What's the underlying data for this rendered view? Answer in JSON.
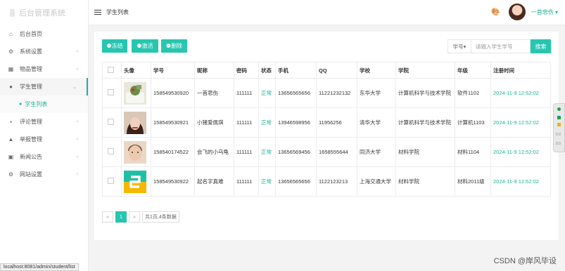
{
  "app": {
    "title": "后台管理系统"
  },
  "header": {
    "page_title": "学生列表",
    "username": "一首悲伤"
  },
  "sidebar": {
    "items": [
      {
        "label": "后台首页",
        "icon": "home-icon"
      },
      {
        "label": "系统设置",
        "icon": "gear-icon"
      },
      {
        "label": "物品管理",
        "icon": "grid-icon"
      },
      {
        "label": "学生管理",
        "icon": "users-icon"
      },
      {
        "label": "评论管理",
        "icon": "comment-icon"
      },
      {
        "label": "举报管理",
        "icon": "warning-icon"
      },
      {
        "label": "新闻公告",
        "icon": "news-icon"
      },
      {
        "label": "网站设置",
        "icon": "gear-icon"
      }
    ],
    "subitem": {
      "label": "学生列表"
    }
  },
  "toolbar": {
    "freeze": "冻结",
    "activate": "激活",
    "delete": "删除"
  },
  "search": {
    "select_value": "学号",
    "placeholder": "请输入学生学号",
    "button": "搜索"
  },
  "table": {
    "headers": [
      "头像",
      "学号",
      "昵称",
      "密码",
      "状态",
      "手机",
      "QQ",
      "学校",
      "学院",
      "年级",
      "注册时间"
    ],
    "rows": [
      {
        "sid": "158549530920",
        "nick": "一首悲伤",
        "pwd": "111111",
        "status": "正常",
        "phone": "13656565656",
        "qq": "11221232132",
        "school": "东华大学",
        "college": "计算机科学与技术学院",
        "grade": "软件1102",
        "time": "2024-11-9 12:52:02"
      },
      {
        "sid": "158549530921",
        "nick": "小猪爱佩琪",
        "pwd": "111111",
        "status": "正常",
        "phone": "13946598956",
        "qq": "11956256",
        "school": "清华大学",
        "college": "计算机科学与技术学院",
        "grade": "计算机1103",
        "time": "2024-11-9 12:52:02"
      },
      {
        "sid": "158540174522",
        "nick": "会飞的小乌龟",
        "pwd": "111111",
        "status": "正常",
        "phone": "13656569456",
        "qq": "1658555644",
        "school": "同济大学",
        "college": "材料学院",
        "grade": "材料1104",
        "time": "2024-11-9 12:52:02"
      },
      {
        "sid": "158549530922",
        "nick": "起名字真难",
        "pwd": "111111",
        "status": "正常",
        "phone": "13656565656",
        "qq": "1122123213",
        "school": "上海交通大学",
        "college": "材料学院",
        "grade": "材料2011级",
        "time": "2024-11-9 12:52:02"
      }
    ]
  },
  "pager": {
    "prev": "«",
    "current": "1",
    "next": "»",
    "info": "共1页,4条数据"
  },
  "statusbar": {
    "url": "localhost:8081/admin/student/list"
  },
  "sidetool": {
    "a": "0.0",
    "b": "0.0"
  },
  "watermark": "CSDN @岸风毕设",
  "colors": {
    "accent": "#26c6b0",
    "green_text": "#1ab394"
  }
}
